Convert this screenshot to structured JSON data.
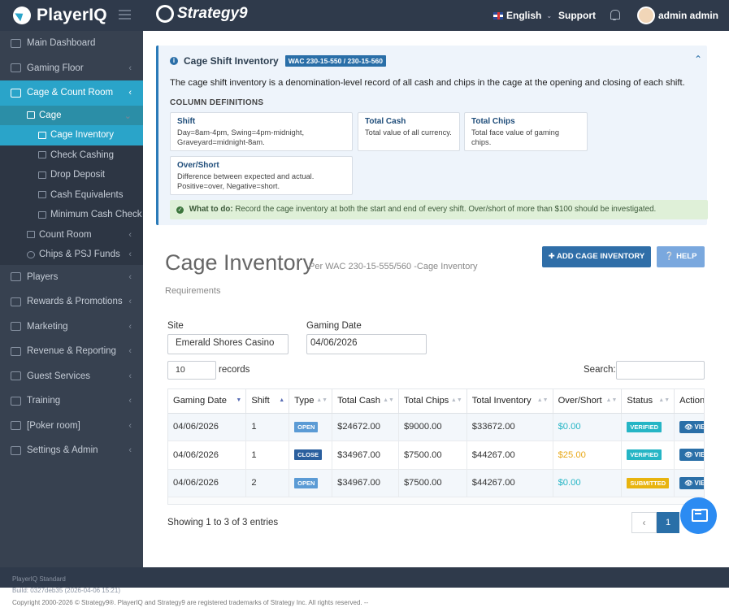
{
  "topbar": {
    "app_name": "PlayerIQ",
    "brand_name": "Strategy9",
    "language": "English",
    "support": "Support",
    "user_name": "admin admin"
  },
  "sidebar": {
    "items": [
      {
        "label": "Main Dashboard",
        "icon": "home-icon"
      },
      {
        "label": "Gaming Floor",
        "icon": "table-icon",
        "chevron": "‹"
      },
      {
        "label": "Cage & Count Room",
        "icon": "lock-icon",
        "chevron": "‹",
        "active": true
      }
    ],
    "cage_group": "Cage",
    "cage_items": [
      "Cage Inventory",
      "Check Cashing",
      "Drop Deposit",
      "Cash Equivalents",
      "Minimum Cash Check"
    ],
    "count_room": "Count Room",
    "chips_funds": "Chips & PSJ Funds",
    "lower_items": [
      {
        "label": "Players",
        "icon": "user-icon"
      },
      {
        "label": "Rewards & Promotions",
        "icon": "star-icon"
      },
      {
        "label": "Marketing",
        "icon": "megaphone-icon"
      },
      {
        "label": "Revenue & Reporting",
        "icon": "money-icon"
      },
      {
        "label": "Guest Services",
        "icon": "users-icon"
      },
      {
        "label": "Training",
        "icon": "graduation-icon"
      },
      {
        "label": "[Poker room]",
        "icon": "diamond-icon"
      },
      {
        "label": "Settings & Admin",
        "icon": "wrench-icon"
      }
    ]
  },
  "info": {
    "title": "Cage Shift Inventory",
    "badge": "WAC 230-15-550 / 230-15-560",
    "description": "The cage shift inventory is a denomination-level record of all cash and chips in the cage at the opening and closing of each shift.",
    "col_defs_title": "COLUMN DEFINITIONS",
    "defs": [
      {
        "term": "Shift",
        "text": "Day=8am-4pm, Swing=4pm-midnight, Graveyard=midnight-8am."
      },
      {
        "term": "Total Cash",
        "text": "Total value of all currency."
      },
      {
        "term": "Total Chips",
        "text": "Total face value of gaming chips."
      },
      {
        "term": "Over/Short",
        "text": "Difference between expected and actual. Positive=over, Negative=short."
      }
    ],
    "what_to_do_label": "What to do:",
    "what_to_do_text": "Record the cage inventory at both the start and end of every shift. Over/short of more than $100 should be investigated."
  },
  "page": {
    "title": "Cage Inventory",
    "subtitle": "Per WAC 230-15-555/560 -Cage Inventory",
    "subtitle2": "Requirements",
    "add_button": "ADD CAGE INVENTORY",
    "help_button": "HELP"
  },
  "filters": {
    "site_label": "Site",
    "site_value": "Emerald Shores Casino",
    "date_label": "Gaming Date",
    "date_value": "04/06/2026",
    "page_length": "10",
    "records_label": "records",
    "search_label": "Search:",
    "search_value": ""
  },
  "table": {
    "headers": [
      "Gaming Date",
      "Shift",
      "Type",
      "Total Cash",
      "Total Chips",
      "Total Inventory",
      "Over/Short",
      "Status",
      "Action"
    ],
    "rows": [
      {
        "date": "04/06/2026",
        "shift": "1",
        "type": "OPEN",
        "cash": "$24672.00",
        "chips": "$9000.00",
        "inventory": "$33672.00",
        "over_short": "$0.00",
        "status": "VERIFIED",
        "action": "VIEW"
      },
      {
        "date": "04/06/2026",
        "shift": "1",
        "type": "CLOSE",
        "cash": "$34967.00",
        "chips": "$7500.00",
        "inventory": "$44267.00",
        "over_short": "$25.00",
        "status": "VERIFIED",
        "action": "VIEW"
      },
      {
        "date": "04/06/2026",
        "shift": "2",
        "type": "OPEN",
        "cash": "$34967.00",
        "chips": "$7500.00",
        "inventory": "$44267.00",
        "over_short": "$0.00",
        "status": "SUBMITTED",
        "action": "VIEW"
      }
    ],
    "showing": "Showing 1 to 3 of 3 entries",
    "page_current": "1",
    "page_prev": "‹"
  },
  "footer": {
    "edition": "PlayerIQ Standard",
    "build": "Build: 0327deb35 (2026-04-06 15:21)",
    "copyright": "Copyright 2000-2026 © Strategy9®. PlayerIQ and Strategy9 are registered trademarks of Strategy Inc. All rights reserved. --"
  },
  "colors": {
    "accent": "#2aa4c9",
    "primary": "#2f6ea8",
    "topbar": "#2f3a4b",
    "sidebar": "#374150",
    "badge_open": "#5b9bd5",
    "badge_close": "#2a5f9e",
    "badge_verified": "#25b5c5",
    "badge_submitted": "#e8b40f"
  }
}
